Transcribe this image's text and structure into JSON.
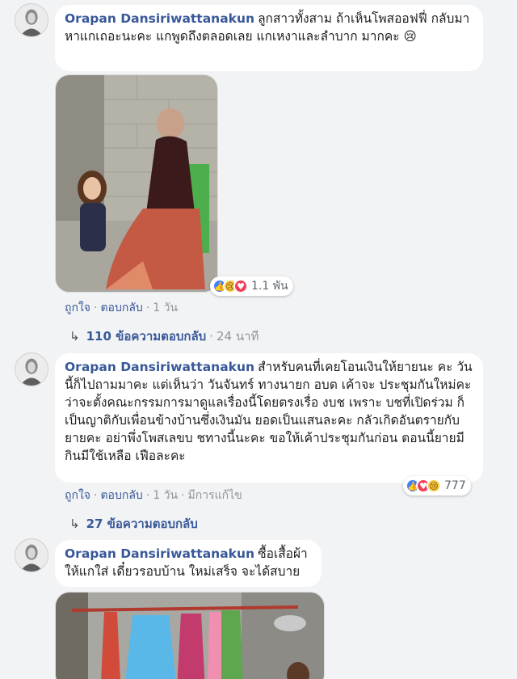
{
  "comments": [
    {
      "author": "Orapan Dansiriwattanakun",
      "text": "ลูกสาวทั้งสาม ถ้าเห็นโพสออฟฟี่ กลับมาหาแกเถอะนะคะ แกพูดถึงตลอดเลย แกเหงาและลำบาก มากคะ 😢",
      "reaction_count": "1.1 พัน",
      "actions": {
        "like": "ถูกใจ",
        "reply": "ตอบกลับ",
        "time": "1 วัน"
      },
      "replies": {
        "label": "110 ข้อความตอบกลับ",
        "time": "24 นาที"
      }
    },
    {
      "author": "Orapan Dansiriwattanakun",
      "text": "สำหรับคนที่เคยโอนเงินให้ยายนะ คะ วันนี้ก็ไปถามมาคะ แต่เห็นว่า วันจันทร์ ทางนายก อบต เค้าจะ ประชุมกันใหม่คะ ว่าจะตั้งคณะกรรมการมาดูแลเรื่องนี้โดยตรงเรื่อ งบช เพราะ บชที่เปิดร่วม ก็เป็นญาติกับเพื่อนข้างบ้านซึ่งเงินมัน ยอดเป็นแสนละคะ กลัวเกิดอันตรายกับยายคะ อย่าพึ่งโพสเลขบ ชทางนี้นะคะ ขอให้เค้าประชุมกันก่อน ตอนนี้ยายมีกินมีใช้เหลือ เฟือละคะ",
      "reaction_count": "777",
      "actions": {
        "like": "ถูกใจ",
        "reply": "ตอบกลับ",
        "time": "1 วัน",
        "edited": "มีการแก้ไข"
      },
      "replies": {
        "label": "27 ข้อความตอบกลับ"
      }
    },
    {
      "author": "Orapan Dansiriwattanakun",
      "text": "ซื้อเสื้อผ้าให้แกใส่ เดี๋ยวรอบบ้าน ใหม่เสร็จ จะได้สบาย"
    }
  ],
  "icons": {
    "reply_arrow": "↳",
    "like": "like-icon",
    "sad": "sad-icon",
    "love": "love-icon"
  },
  "colors": {
    "author": "#385898",
    "background": "#f2f3f5",
    "like": "#4080ff",
    "love": "#f33e58",
    "sad": "#f7c943"
  }
}
